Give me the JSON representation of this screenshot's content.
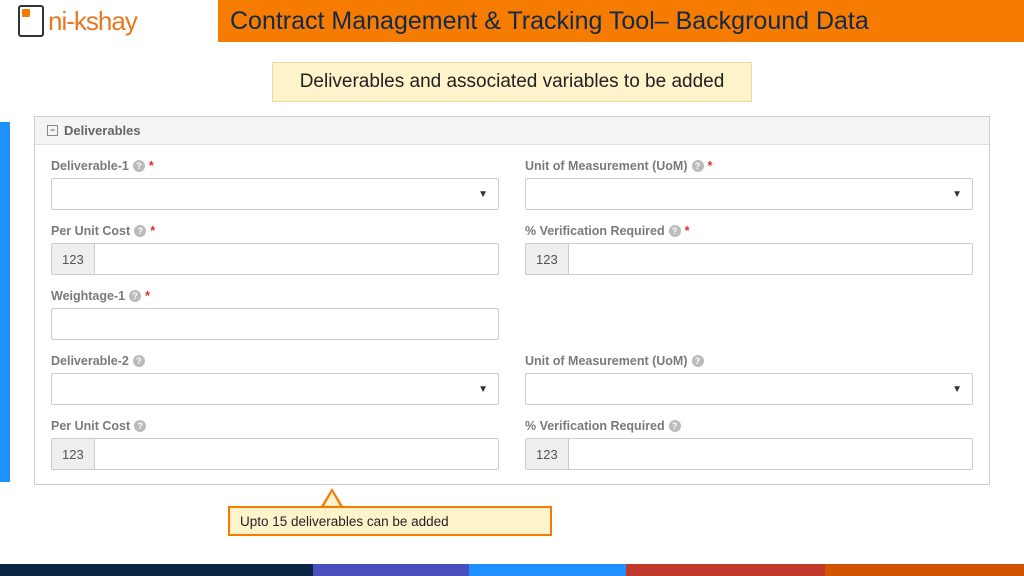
{
  "logo": {
    "text": "ni-kshay"
  },
  "header": {
    "title": "Contract Management & Tracking Tool– Background Data"
  },
  "subtitle": "Deliverables and associated variables to be added",
  "panel": {
    "title": "Deliverables"
  },
  "fields": {
    "deliverable1": {
      "label": "Deliverable-1",
      "required": true
    },
    "uom1": {
      "label": "Unit of Measurement (UoM)",
      "required": true
    },
    "perUnit1": {
      "label": "Per Unit Cost",
      "required": true,
      "addon": "123"
    },
    "verify1": {
      "label": "% Verification Required",
      "required": true,
      "addon": "123"
    },
    "weight1": {
      "label": "Weightage-1",
      "required": true
    },
    "deliverable2": {
      "label": "Deliverable-2",
      "required": false
    },
    "uom2": {
      "label": "Unit of Measurement (UoM)",
      "required": false
    },
    "perUnit2": {
      "label": "Per Unit Cost",
      "required": false,
      "addon": "123"
    },
    "verify2": {
      "label": "% Verification Required",
      "required": false,
      "addon": "123"
    }
  },
  "callout": "Upto 15 deliverables can be added"
}
